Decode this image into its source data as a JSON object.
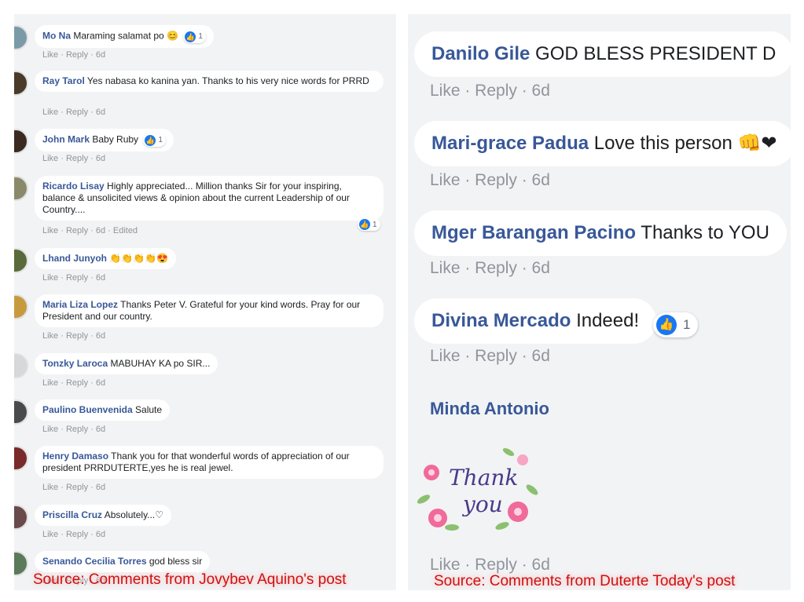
{
  "left_panel": {
    "comments": [
      {
        "author": "Mo Na",
        "text": "Maraming salamat po 😊",
        "reactions": "1",
        "meta": "Like · Reply · 6d"
      },
      {
        "author": "Ray Tarol",
        "text": "Yes nabasa ko kanina yan. Thanks to his very nice words for PRRD",
        "meta": "Like · Reply · 6d"
      },
      {
        "author": "John Mark",
        "text": "Baby Ruby",
        "reactions": "1",
        "meta": "Like · Reply · 6d"
      },
      {
        "author": "Ricardo Lisay",
        "text": "Highly appreciated... Million thanks Sir for your inspiring, balance & unsolicited views & opinion about the current Leadership of our Country....",
        "reactions": "1",
        "meta": "Like · Reply · 6d · Edited"
      },
      {
        "author": "Lhand Junyoh",
        "text": "👏👏👏👏😍",
        "meta": "Like · Reply · 6d"
      },
      {
        "author": "Maria Liza Lopez",
        "text": "Thanks Peter V. Grateful for your kind words. Pray for our President and our country.",
        "meta": "Like · Reply · 6d"
      },
      {
        "author": "Tonzky Laroca",
        "text": "MABUHAY KA po SIR...",
        "meta": "Like · Reply · 6d"
      },
      {
        "author": "Paulino Buenvenida",
        "text": "Salute",
        "meta": "Like · Reply · 6d"
      },
      {
        "author": "Henry Damaso",
        "text": "Thank you for that wonderful words of appreciation of our president PRRDUTERTE,yes he is real jewel.",
        "meta": "Like · Reply · 6d"
      },
      {
        "author": "Priscilla Cruz",
        "text": "Absolutely...♡",
        "meta": "Like · Reply · 6d"
      },
      {
        "author": "Senando Cecilia Torres",
        "text": "god bless sir",
        "meta": "Like · Reply · 6d"
      }
    ],
    "source": "Source: Comments from Jovybev Aquino's post"
  },
  "right_panel": {
    "comments": [
      {
        "author": "Danilo Gile",
        "text": "GOD BLESS PRESIDENT D",
        "meta": "Like · Reply · 6d"
      },
      {
        "author": "Mari-grace Padua",
        "text": "Love this person 👊❤",
        "meta": "Like · Reply · 6d"
      },
      {
        "author": "Mger Barangan Pacino",
        "text": "Thanks to YOU",
        "meta": "Like · Reply · 6d"
      },
      {
        "author": "Divina Mercado",
        "text": "Indeed!",
        "reactions": "1",
        "meta": "Like · Reply · 6d"
      },
      {
        "author": "Minda Antonio",
        "text": "",
        "meta": "Like · Reply · 6d"
      }
    ],
    "sticker_text": [
      "Thank",
      "you"
    ],
    "source": "Source: Comments from Duterte Today's post"
  },
  "icons": {
    "like": "like-thumb-icon"
  },
  "colors": {
    "author": "#385898",
    "like_blue": "#1877f2",
    "source_red": "#cc1111",
    "panel_bg": "#f2f3f5"
  }
}
